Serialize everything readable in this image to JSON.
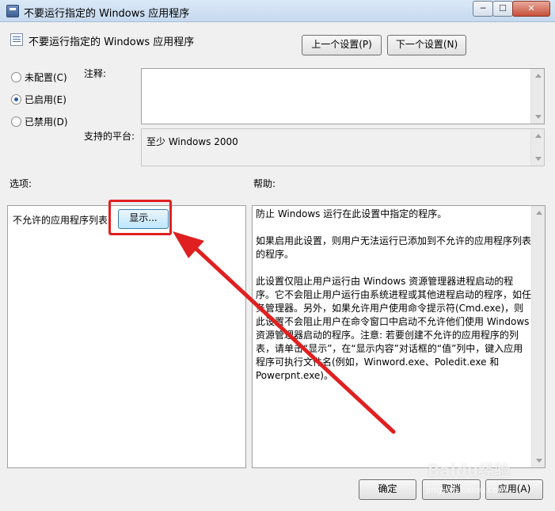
{
  "window": {
    "title": "不要运行指定的 Windows 应用程序",
    "controls": {
      "minimize": "─",
      "maximize": "☐",
      "close": "✕"
    }
  },
  "header": {
    "policy_title": "不要运行指定的 Windows 应用程序",
    "prev_button": "上一个设置(P)",
    "next_button": "下一个设置(N)"
  },
  "state": {
    "options": [
      {
        "label": "未配置(C)",
        "checked": false
      },
      {
        "label": "已启用(E)",
        "checked": true
      },
      {
        "label": "已禁用(D)",
        "checked": false
      }
    ]
  },
  "comment": {
    "label": "注释:",
    "value": ""
  },
  "platform": {
    "label": "支持的平台:",
    "value": "至少 Windows 2000"
  },
  "options_section": {
    "heading": "选项:",
    "item_label": "不允许的应用程序列表",
    "show_button": "显示..."
  },
  "help_section": {
    "heading": "帮助:",
    "paragraphs": [
      "防止 Windows 运行在此设置中指定的程序。",
      "如果启用此设置，则用户无法运行已添加到不允许的应用程序列表的程序。",
      "此设置仅阻止用户运行由 Windows 资源管理器进程启动的程序。它不会阻止用户运行由系统进程或其他进程启动的程序，如任务管理器。另外，如果允许用户使用命令提示符(Cmd.exe)，则此设置不会阻止用户在命令窗口中启动不允许他们使用 Windows 资源管理器启动的程序。注意: 若要创建不允许的应用程序的列表，请单击“显示”，在“显示内容”对话框的“值”列中，键入应用程序可执行文件名(例如，Winword.exe、Poledit.exe 和 Powerpnt.exe)。"
    ]
  },
  "footer": {
    "ok_button": "确定",
    "cancel_button": "取消",
    "apply_button": "应用(A)"
  },
  "watermark": {
    "logo": "Baidu经验",
    "url": "jingyan.baidu.com"
  },
  "colors": {
    "annotation_red": "#e02020",
    "title_bar": "#c5d9ef",
    "radio_checked": "#2a5fa8"
  }
}
